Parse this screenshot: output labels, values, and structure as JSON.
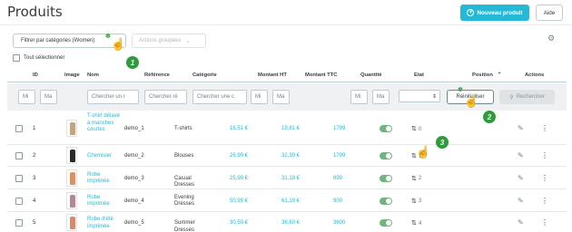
{
  "header": {
    "title": "Produits",
    "new_product_label": "Nouveau produit",
    "help_label": "Aide"
  },
  "toolbar": {
    "filter_button_label": "Filtrer par catégories (Women)",
    "bulk_actions_label": "Actions groupées",
    "select_all_label": "Tout sélectionner"
  },
  "columns": {
    "id": "ID",
    "image": "Image",
    "name": "Nom",
    "reference": "Référence",
    "category": "Catégorie",
    "price_ht": "Montant HT",
    "price_ttc": "Montant TTC",
    "quantity": "Quantité",
    "status": "Etat",
    "position": "Position",
    "actions": "Actions"
  },
  "filters": {
    "id_min": "Mi",
    "id_max": "Ma",
    "name_placeholder": "Chercher un r",
    "reference_placeholder": "Chercher ré",
    "category_placeholder": "Chercher une c",
    "ht_min": "Mi",
    "ht_max": "Ma",
    "qty_min": "Mi",
    "qty_max": "Ma",
    "status_value": "",
    "reset_label": "Réinitialiser",
    "search_label": "Rechercher"
  },
  "rows": [
    {
      "id": "1",
      "name": "T-shirt délavé à manches courtes",
      "reference": "demo_1",
      "category": "T-shirts",
      "price_ht": "16,51 €",
      "price_ttc": "19,81 €",
      "quantity": "1799",
      "enabled": true,
      "position": "0",
      "thumb_color": "#c9a27a"
    },
    {
      "id": "2",
      "name": "Chemisier",
      "reference": "demo_2",
      "category": "Blouses",
      "price_ht": "26,99 €",
      "price_ttc": "32,39 €",
      "quantity": "1799",
      "enabled": true,
      "position": "1",
      "thumb_color": "#2b2b2b"
    },
    {
      "id": "3",
      "name": "Robe imprimée",
      "reference": "demo_3",
      "category": "Casual Dresses",
      "price_ht": "25,99 €",
      "price_ttc": "31,19 €",
      "quantity": "899",
      "enabled": true,
      "position": "2",
      "thumb_color": "#e0905a"
    },
    {
      "id": "4",
      "name": "Robe imprimée",
      "reference": "demo_4",
      "category": "Evening Dresses",
      "price_ht": "50,99 €",
      "price_ttc": "61,19 €",
      "quantity": "900",
      "enabled": true,
      "position": "3",
      "thumb_color": "#b7859a"
    },
    {
      "id": "5",
      "name": "Robe d'été imprimée",
      "reference": "demo_5",
      "category": "Summer Dresses",
      "price_ht": "30,50 €",
      "price_ttc": "36,60 €",
      "quantity": "3600",
      "enabled": true,
      "position": "4",
      "thumb_color": "#d98a6a"
    }
  ],
  "markers": [
    "1",
    "2",
    "3"
  ],
  "colors": {
    "accent": "#25b9d7",
    "toggle_on": "#70b580",
    "marker": "#2e9c3a"
  }
}
